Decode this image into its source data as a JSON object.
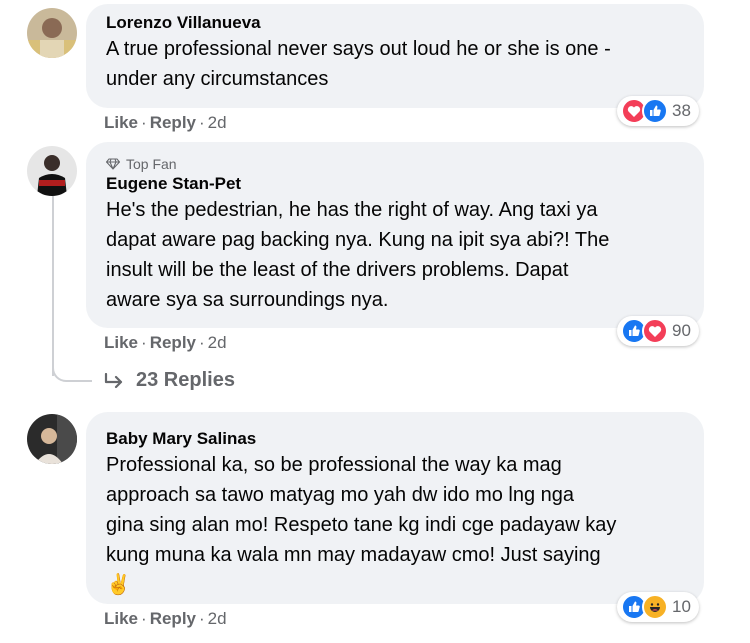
{
  "comments": [
    {
      "author": "Lorenzo Villanueva",
      "lines": [
        "A true professional never says out loud he or she is one -",
        "under any circumstances"
      ],
      "actions": {
        "like": "Like",
        "reply": "Reply",
        "time": "2d"
      },
      "reactions": {
        "icons": [
          "love-icon",
          "like-icon"
        ],
        "count": "38"
      }
    },
    {
      "badge": "Top Fan",
      "author": "Eugene Stan-Pet",
      "lines": [
        "He's the pedestrian, he has the right of way. Ang taxi ya",
        "dapat aware pag backing nya. Kung na ipit sya abi?! The",
        "insult will be the least of the drivers problems. Dapat",
        "aware sya sa surroundings nya."
      ],
      "actions": {
        "like": "Like",
        "reply": "Reply",
        "time": "2d"
      },
      "reactions": {
        "icons": [
          "like-icon",
          "love-icon"
        ],
        "count": "90"
      },
      "replies_label": "23 Replies"
    },
    {
      "author": "Baby Mary Salinas",
      "lines": [
        "Professional ka, so be professional the way ka mag",
        "approach sa tawo matyag mo yah dw ido mo lng nga",
        "gina sing alan mo! Respeto tane kg indi cge padayaw kay",
        "kung muna ka wala mn may madayaw cmo! Just saying",
        "✌️"
      ],
      "actions": {
        "like": "Like",
        "reply": "Reply",
        "time": "2d"
      },
      "reactions": {
        "icons": [
          "like-icon",
          "haha-icon"
        ],
        "count": "10"
      }
    }
  ],
  "colors": {
    "bubble": "#f0f2f5",
    "secondary_text": "#65676b",
    "like_blue": "#1877f2",
    "love_red": "#f33e58",
    "haha_yellow": "#f7b125"
  }
}
